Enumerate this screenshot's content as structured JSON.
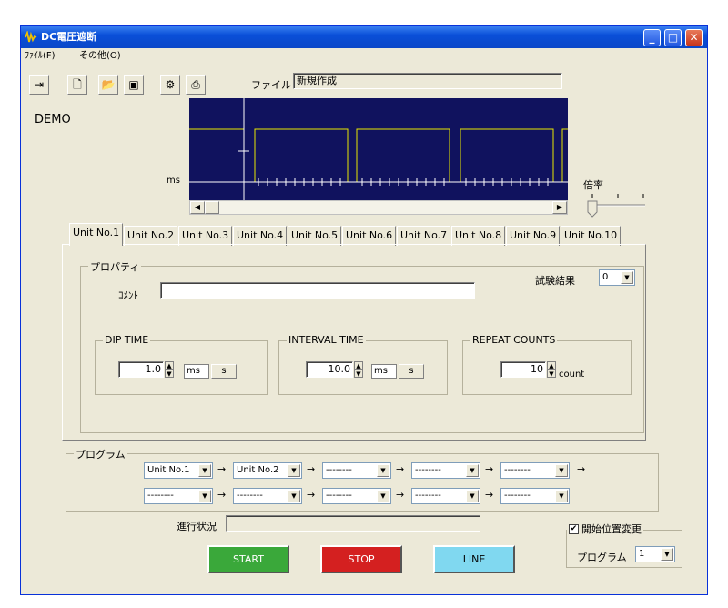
{
  "window": {
    "title": "DC電圧遮断",
    "icon": "app-waveform-icon"
  },
  "menu": {
    "file": "ﾌｧｲﾙ(F)",
    "other": "その他(O)"
  },
  "toolbar": {
    "icons": [
      "exit-icon",
      "new-file-icon",
      "open-folder-icon",
      "save-icon",
      "settings-icon",
      "print-preview-icon"
    ],
    "file_label": "ファイル",
    "file_value": "新規作成"
  },
  "demo_label": "DEMO",
  "chart": {
    "unit_label": "ms",
    "zoom_label": "倍率"
  },
  "tabs": [
    "Unit No.1",
    "Unit No.2",
    "Unit No.3",
    "Unit No.4",
    "Unit No.5",
    "Unit No.6",
    "Unit No.7",
    "Unit No.8",
    "Unit No.9",
    "Unit No.10"
  ],
  "properties": {
    "title": "プロパティ",
    "test_result_label": "試験結果",
    "test_result_value": "0",
    "comment_label": "ｺﾒﾝﾄ",
    "comment_value": "",
    "dip_time": {
      "title": "DIP TIME",
      "value": "1.0",
      "unit_ms": "ms",
      "unit_s": "s"
    },
    "interval_time": {
      "title": "INTERVAL TIME",
      "value": "10.0",
      "unit_ms": "ms",
      "unit_s": "s"
    },
    "repeat_counts": {
      "title": "REPEAT COUNTS",
      "value": "10",
      "unit": "count"
    }
  },
  "program": {
    "title": "プログラム",
    "row1": [
      "Unit No.1",
      "Unit No.2",
      "--------",
      "--------",
      "--------"
    ],
    "row2": [
      "--------",
      "--------",
      "--------",
      "--------",
      "--------"
    ],
    "arrow": "→"
  },
  "progress_label": "進行状況",
  "start_pos": {
    "checkbox_label": "開始位置変更",
    "checked": true,
    "program_label": "プログラム",
    "program_value": "1"
  },
  "buttons": {
    "start": "START",
    "stop": "STOP",
    "line": "LINE"
  },
  "colors": {
    "chart_bg": "#10125e",
    "wave": "#e8e800",
    "start": "#3aa83a",
    "stop": "#d42020",
    "line": "#80d8f0"
  }
}
